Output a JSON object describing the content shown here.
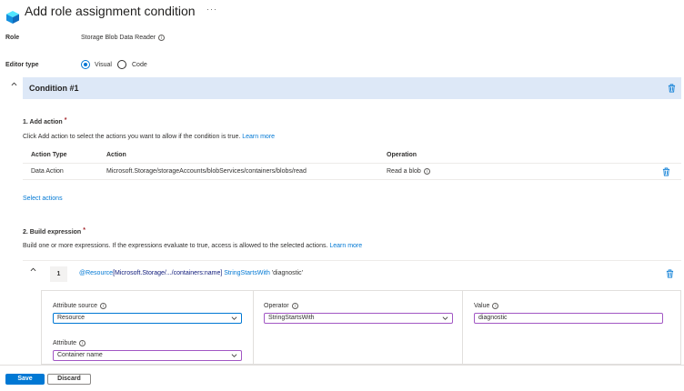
{
  "header": {
    "title": "Add role assignment condition",
    "more": "···"
  },
  "role": {
    "label": "Role",
    "value": "Storage Blob Data Reader"
  },
  "editor_type": {
    "label": "Editor type",
    "options": [
      "Visual",
      "Code"
    ],
    "selected": "Visual"
  },
  "condition": {
    "title": "Condition #1"
  },
  "add_action": {
    "heading": "1. Add action",
    "required_mark": "*",
    "description": "Click Add action to select the actions you want to allow if the condition is true.",
    "learn_more": "Learn more",
    "columns": [
      "Action Type",
      "Action",
      "Operation"
    ],
    "rows": [
      {
        "type": "Data Action",
        "action": "Microsoft.Storage/storageAccounts/blobServices/containers/blobs/read",
        "operation": "Read a blob"
      }
    ],
    "select_actions": "Select actions"
  },
  "build_expression": {
    "heading": "2. Build expression",
    "required_mark": "*",
    "description": "Build one or more expressions. If the expressions evaluate to true, access is allowed to the selected actions.",
    "learn_more": "Learn more",
    "expression": {
      "number": "1",
      "part_attr": "@Resource",
      "part_path": "[Microsoft.Storage/.../containers:name]",
      "part_op": "StringStartsWith",
      "part_value": "'diagnostic'"
    },
    "attribute_source": {
      "label": "Attribute source",
      "value": "Resource"
    },
    "attribute": {
      "label": "Attribute",
      "value": "Container name"
    },
    "operator": {
      "label": "Operator",
      "value": "StringStartsWith"
    },
    "value": {
      "label": "Value",
      "value": "diagnostic"
    }
  },
  "footer": {
    "save": "Save",
    "discard": "Discard"
  },
  "colors": {
    "accent": "#0078d4",
    "condition_bar": "#dde8f7",
    "select_border": "#a257c4"
  }
}
